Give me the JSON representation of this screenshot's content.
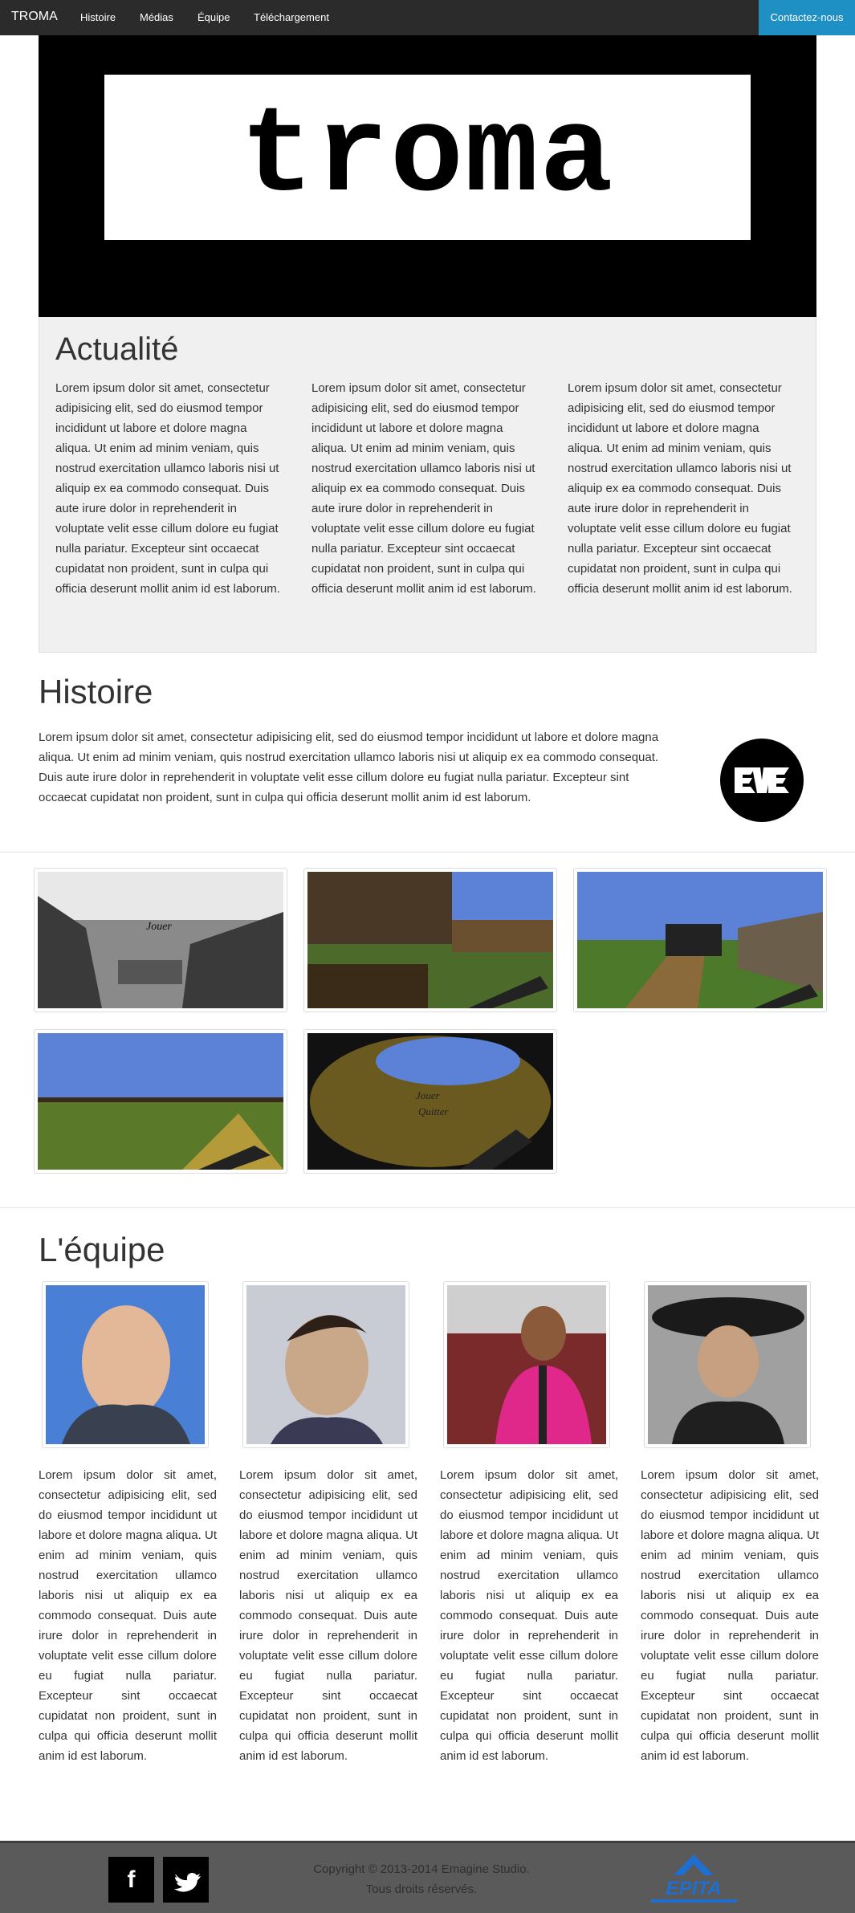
{
  "navbar": {
    "brand": "TROMA",
    "links": [
      "Histoire",
      "Médias",
      "Équipe",
      "Téléchargement"
    ],
    "contact": "Contactez-nous",
    "colors": {
      "bar": "#2b2b2b",
      "accent": "#1e90c4"
    }
  },
  "hero": {
    "logo_text": "troma"
  },
  "news": {
    "title": "Actualité",
    "columns": [
      "Lorem ipsum dolor sit amet, consectetur adipisicing elit, sed do eiusmod tempor incididunt ut labore et dolore magna aliqua. Ut enim ad minim veniam, quis nostrud exercitation ullamco laboris nisi ut aliquip ex ea commodo consequat. Duis aute irure dolor in reprehenderit in voluptate velit esse cillum dolore eu fugiat nulla pariatur. Excepteur sint occaecat cupidatat non proident, sunt in culpa qui officia deserunt mollit anim id est laborum.",
      "Lorem ipsum dolor sit amet, consectetur adipisicing elit, sed do eiusmod tempor incididunt ut labore et dolore magna aliqua. Ut enim ad minim veniam, quis nostrud exercitation ullamco laboris nisi ut aliquip ex ea commodo consequat. Duis aute irure dolor in reprehenderit in voluptate velit esse cillum dolore eu fugiat nulla pariatur. Excepteur sint occaecat cupidatat non proident, sunt in culpa qui officia deserunt mollit anim id est laborum.",
      "Lorem ipsum dolor sit amet, consectetur adipisicing elit, sed do eiusmod tempor incididunt ut labore et dolore magna aliqua. Ut enim ad minim veniam, quis nostrud exercitation ullamco laboris nisi ut aliquip ex ea commodo consequat. Duis aute irure dolor in reprehenderit in voluptate velit esse cillum dolore eu fugiat nulla pariatur. Excepteur sint occaecat cupidatat non proident, sunt in culpa qui officia deserunt mollit anim id est laborum."
    ]
  },
  "histoire": {
    "title": "Histoire",
    "text": "Lorem ipsum dolor sit amet, consectetur adipisicing elit, sed do eiusmod tempor incididunt ut labore et dolore magna aliqua. Ut enim ad minim veniam, quis nostrud exercitation ullamco laboris nisi ut aliquip ex ea commodo consequat. Duis aute irure dolor in reprehenderit in voluptate velit esse cillum dolore eu fugiat nulla pariatur. Excepteur sint occaecat cupidatat non proident, sunt in culpa qui officia deserunt mollit anim id est laborum.",
    "badge_text": "EVE"
  },
  "gallery": {
    "captions": [
      "Jouer",
      "Jouer",
      "Quitter"
    ]
  },
  "team": {
    "title": "L'équipe",
    "bios": [
      "Lorem ipsum dolor sit amet, consectetur adipisicing elit, sed do eiusmod tempor incididunt ut labore et dolore magna aliqua. Ut enim ad minim veniam, quis nostrud exercitation ullamco laboris nisi ut aliquip ex ea commodo consequat. Duis aute irure dolor in reprehenderit in voluptate velit esse cillum dolore eu fugiat nulla pariatur. Excepteur sint occaecat cupidatat non proident, sunt in culpa qui officia deserunt mollit anim id est laborum.",
      "Lorem ipsum dolor sit amet, consectetur adipisicing elit, sed do eiusmod tempor incididunt ut labore et dolore magna aliqua. Ut enim ad minim veniam, quis nostrud exercitation ullamco laboris nisi ut aliquip ex ea commodo consequat. Duis aute irure dolor in reprehenderit in voluptate velit esse cillum dolore eu fugiat nulla pariatur. Excepteur sint occaecat cupidatat non proident, sunt in culpa qui officia deserunt mollit anim id est laborum.",
      "Lorem ipsum dolor sit amet, consectetur adipisicing elit, sed do eiusmod tempor incididunt ut labore et dolore magna aliqua. Ut enim ad minim veniam, quis nostrud exercitation ullamco laboris nisi ut aliquip ex ea commodo consequat. Duis aute irure dolor in reprehenderit in voluptate velit esse cillum dolore eu fugiat nulla pariatur. Excepteur sint occaecat cupidatat non proident, sunt in culpa qui officia deserunt mollit anim id est laborum.",
      "Lorem ipsum dolor sit amet, consectetur adipisicing elit, sed do eiusmod tempor incididunt ut labore et dolore magna aliqua. Ut enim ad minim veniam, quis nostrud exercitation ullamco laboris nisi ut aliquip ex ea commodo consequat. Duis aute irure dolor in reprehenderit in voluptate velit esse cillum dolore eu fugiat nulla pariatur. Excepteur sint occaecat cupidatat non proident, sunt in culpa qui officia deserunt mollit anim id est laborum."
    ]
  },
  "footer": {
    "copyright_line1": "Copyright © 2013-2014 Emagine Studio.",
    "copyright_line2": "Tous droits réservés.",
    "facebook_glyph": "f",
    "twitter_icon": "twitter-bird-icon",
    "partner_logo": "EPITA"
  }
}
